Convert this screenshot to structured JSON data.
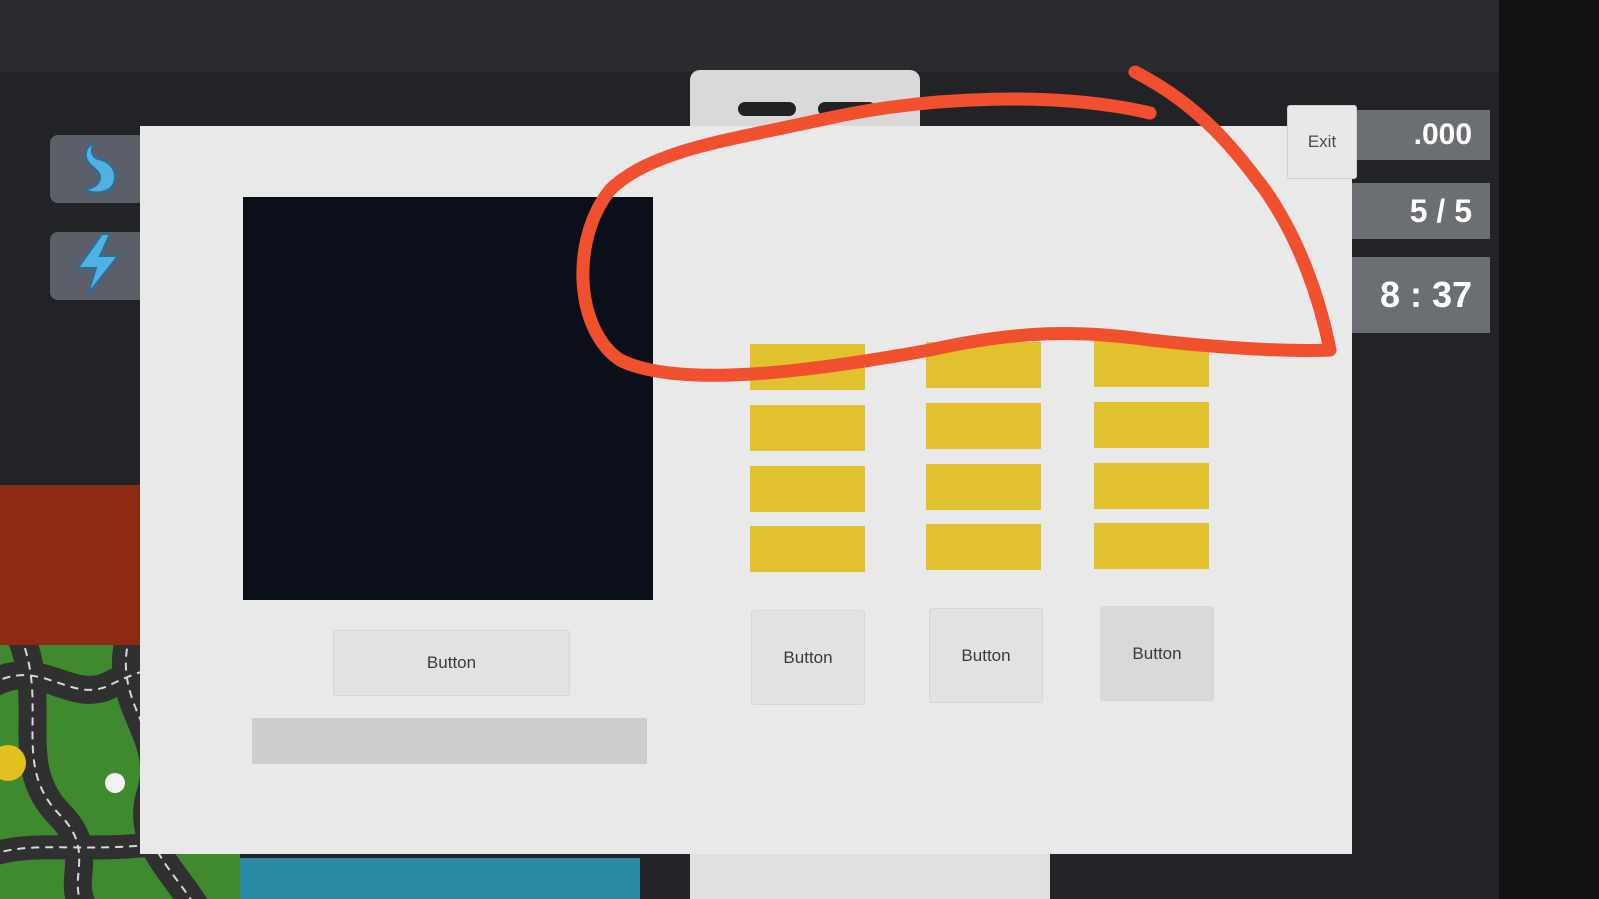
{
  "hud": {
    "money_text": ".000",
    "count_text": "5 / 5",
    "time_text": "8 : 37",
    "icons": [
      "stomach-icon",
      "lightning-icon"
    ]
  },
  "panel": {
    "exit_label": "Exit",
    "preview_button_label": "Button",
    "column_buttons": [
      "Button",
      "Button",
      "Button"
    ],
    "yellow_slots_per_column": 4
  },
  "colors": {
    "panel_bg": "#e9e9e9",
    "slot_yellow": "#e2c12e",
    "preview_bg": "#0b0f1a",
    "annotation_red": "#f0502e"
  }
}
